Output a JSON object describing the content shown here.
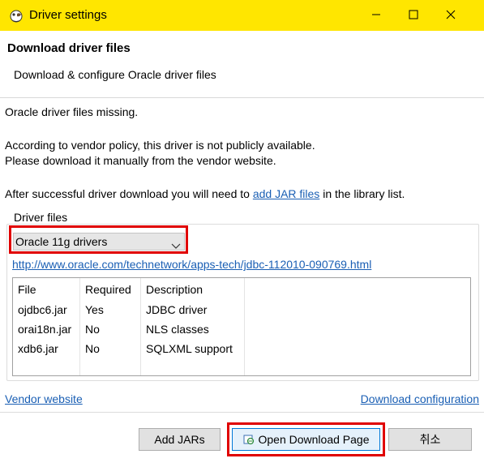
{
  "window": {
    "title": "Driver settings"
  },
  "header": {
    "title": "Download driver files",
    "subtitle": "Download & configure Oracle driver files"
  },
  "messages": {
    "missing": "Oracle driver files missing.",
    "policy_1": "According to vendor policy, this driver is not publicly available.",
    "policy_2": "Please download it manually from the vendor website.",
    "after_prefix": "After successful driver download you will need to ",
    "after_link": "add JAR files",
    "after_suffix": " in the library list."
  },
  "driver_files": {
    "group_label": "Driver files",
    "selected_driver": "Oracle 11g drivers",
    "url": "http://www.oracle.com/technetwork/apps-tech/jdbc-112010-090769.html",
    "columns": [
      "File",
      "Required",
      "Description"
    ],
    "rows": [
      {
        "file": "ojdbc6.jar",
        "required": "Yes",
        "description": "JDBC driver"
      },
      {
        "file": "orai18n.jar",
        "required": "No",
        "description": "NLS classes"
      },
      {
        "file": "xdb6.jar",
        "required": "No",
        "description": "SQLXML support"
      }
    ]
  },
  "links": {
    "vendor_website": "Vendor website",
    "download_configuration": "Download configuration"
  },
  "buttons": {
    "add_jars": "Add JARs",
    "open_download_page": "Open Download Page",
    "cancel": "취소"
  },
  "colors": {
    "title_bar": "#ffe600",
    "link": "#1a5fb4",
    "highlight": "#e00000"
  }
}
